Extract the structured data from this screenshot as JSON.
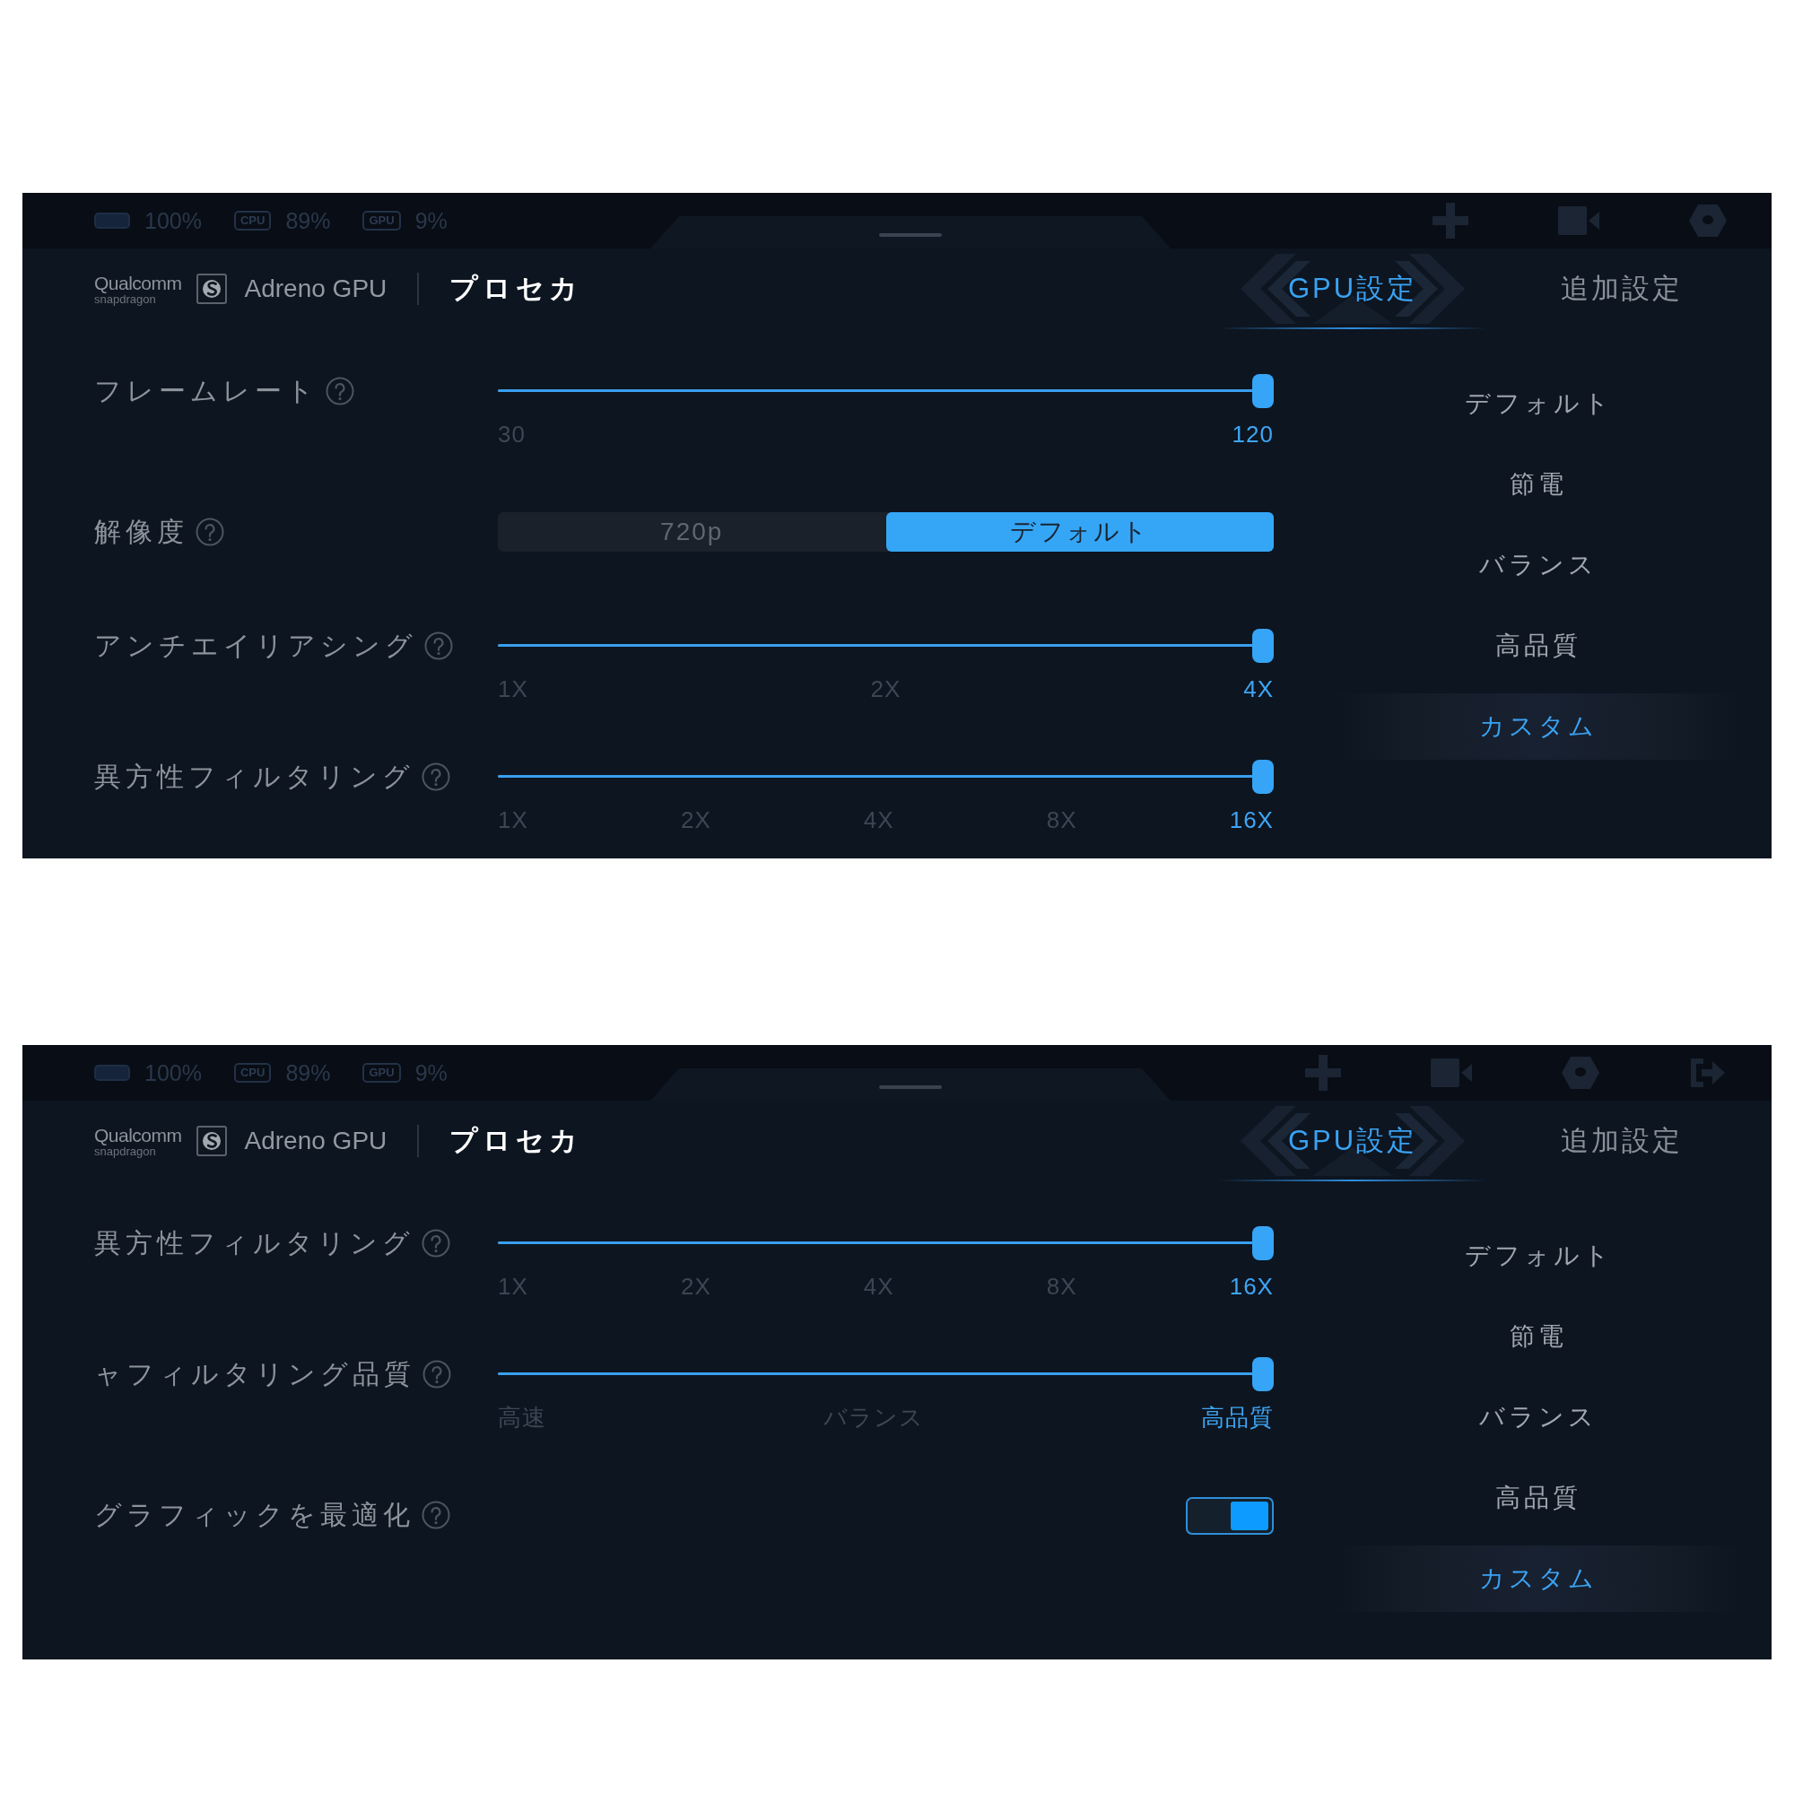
{
  "panels": [
    {
      "status": [
        {
          "kind": "battery",
          "value": "100%"
        },
        {
          "kind": "chip",
          "label": "CPU",
          "value": "89%"
        },
        {
          "kind": "chip",
          "label": "GPU",
          "value": "9%"
        }
      ],
      "toolbar": [
        {
          "kind": "add"
        },
        {
          "kind": "record"
        },
        {
          "kind": "settings"
        }
      ],
      "brand": {
        "logo_line_1": "Qualcomm",
        "logo_line_2": "snapdragon",
        "product": "Adreno GPU"
      },
      "app_name": "プロセカ",
      "tabs": [
        {
          "label": "GPU設定",
          "selected": true
        },
        {
          "label": "追加設定",
          "selected": false
        }
      ],
      "settings": [
        {
          "kind": "slider",
          "label": "フレームレート",
          "level": 1,
          "ticks": [
            {
              "label": "30",
              "selected": false
            },
            {
              "label": "120",
              "selected": true
            }
          ]
        },
        {
          "kind": "segmented",
          "label": "解像度",
          "options": [
            {
              "label": "720p",
              "selected": false
            },
            {
              "label": "デフォルト",
              "selected": true
            }
          ]
        },
        {
          "kind": "slider",
          "label": "アンチエイリアシング",
          "level": 1,
          "ticks": [
            {
              "label": "1X",
              "selected": false
            },
            {
              "label": "2X",
              "selected": false
            },
            {
              "label": "4X",
              "selected": true
            }
          ]
        },
        {
          "kind": "slider",
          "label": "異方性フィルタリング",
          "level": 1,
          "ticks": [
            {
              "label": "1X",
              "selected": false
            },
            {
              "label": "2X",
              "selected": false
            },
            {
              "label": "4X",
              "selected": false
            },
            {
              "label": "8X",
              "selected": false
            },
            {
              "label": "16X",
              "selected": true
            }
          ]
        }
      ],
      "presets": [
        {
          "label": "デフォルト",
          "selected": false
        },
        {
          "label": "節電",
          "selected": false
        },
        {
          "label": "バランス",
          "selected": false
        },
        {
          "label": "高品質",
          "selected": false
        },
        {
          "label": "カスタム",
          "selected": true
        }
      ]
    },
    {
      "status": [
        {
          "kind": "battery",
          "value": "100%"
        },
        {
          "kind": "chip",
          "label": "CPU",
          "value": "89%"
        },
        {
          "kind": "chip",
          "label": "GPU",
          "value": "9%"
        }
      ],
      "toolbar": [
        {
          "kind": "add"
        },
        {
          "kind": "record"
        },
        {
          "kind": "settings"
        },
        {
          "kind": "exit"
        }
      ],
      "brand": {
        "logo_line_1": "Qualcomm",
        "logo_line_2": "snapdragon",
        "product": "Adreno GPU"
      },
      "app_name": "プロセカ",
      "tabs": [
        {
          "label": "GPU設定",
          "selected": true
        },
        {
          "label": "追加設定",
          "selected": false
        }
      ],
      "settings": [
        {
          "kind": "slider",
          "label": "異方性フィルタリング",
          "level": 1,
          "ticks": [
            {
              "label": "1X",
              "selected": false
            },
            {
              "label": "2X",
              "selected": false
            },
            {
              "label": "4X",
              "selected": false
            },
            {
              "label": "8X",
              "selected": false
            },
            {
              "label": "16X",
              "selected": true
            }
          ]
        },
        {
          "kind": "slider",
          "label": "ャフィルタリング品質",
          "level": 1,
          "ticks": [
            {
              "label": "高速",
              "selected": false
            },
            {
              "label": "バランス",
              "selected": false
            },
            {
              "label": "高品質",
              "selected": true
            }
          ]
        },
        {
          "kind": "toggle",
          "label": "グラフィックを最適化",
          "on": true
        }
      ],
      "presets": [
        {
          "label": "デフォルト",
          "selected": false
        },
        {
          "label": "節電",
          "selected": false
        },
        {
          "label": "バランス",
          "selected": false
        },
        {
          "label": "高品質",
          "selected": false
        },
        {
          "label": "カスタム",
          "selected": true
        }
      ]
    }
  ]
}
